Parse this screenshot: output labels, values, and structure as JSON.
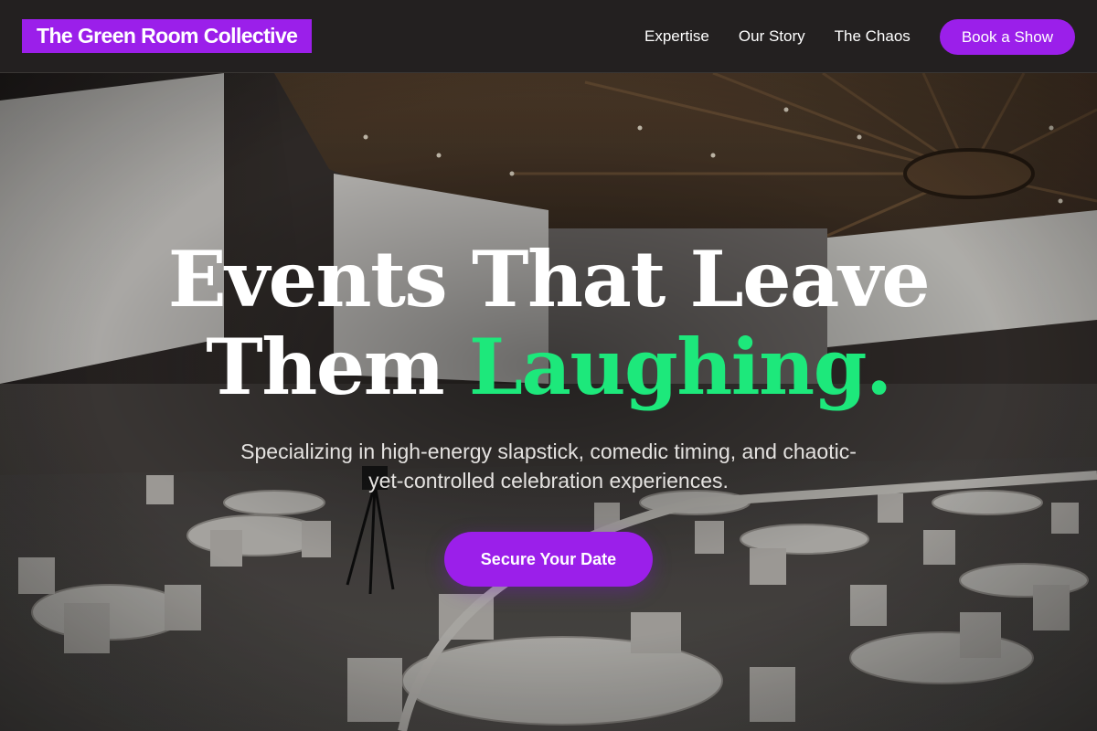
{
  "header": {
    "logo": "The Green Room Collective",
    "nav": [
      {
        "label": "Expertise"
      },
      {
        "label": "Our Story"
      },
      {
        "label": "The Chaos"
      }
    ],
    "cta_label": "Book a Show"
  },
  "hero": {
    "title_line1": "Events That Leave",
    "title_line2_plain": "Them ",
    "title_line2_accent": "Laughing.",
    "subtitle": "Specializing in high-energy slapstick, comedic timing, and chaotic-yet-controlled celebration experiences.",
    "cta_label": "Secure Your Date",
    "background_description_icon": "event-hall-photo"
  },
  "colors": {
    "brand_purple": "#9b1fea",
    "accent_green": "#1de87b",
    "header_bg": "#232020"
  }
}
